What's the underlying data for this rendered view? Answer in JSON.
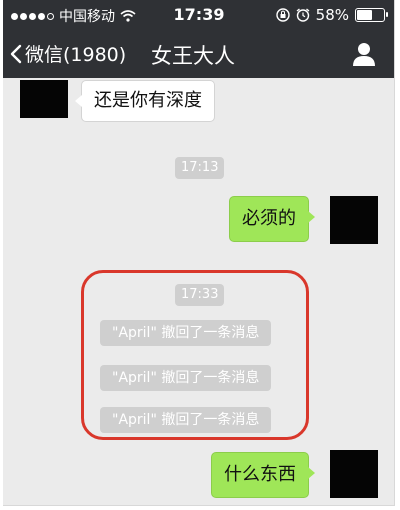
{
  "status_bar": {
    "carrier": "中国移动",
    "time": "17:39",
    "battery_text": "58%",
    "battery_level": 0.58
  },
  "nav": {
    "back_label": "微信(1980)",
    "title": "女王大人"
  },
  "messages": {
    "incoming_1": "还是你有深度",
    "timestamp_1": "17:13",
    "outgoing_1": "必须的",
    "timestamp_2": "17:33",
    "recall_1": "\"April\" 撤回了一条消息",
    "recall_2": "\"April\" 撤回了一条消息",
    "recall_3": "\"April\" 撤回了一条消息",
    "outgoing_2": "什么东西"
  },
  "colors": {
    "bar": "#2f3135",
    "chat_bg": "#ebebeb",
    "outgoing_bubble": "#9fe658",
    "highlight": "#d9372b"
  }
}
